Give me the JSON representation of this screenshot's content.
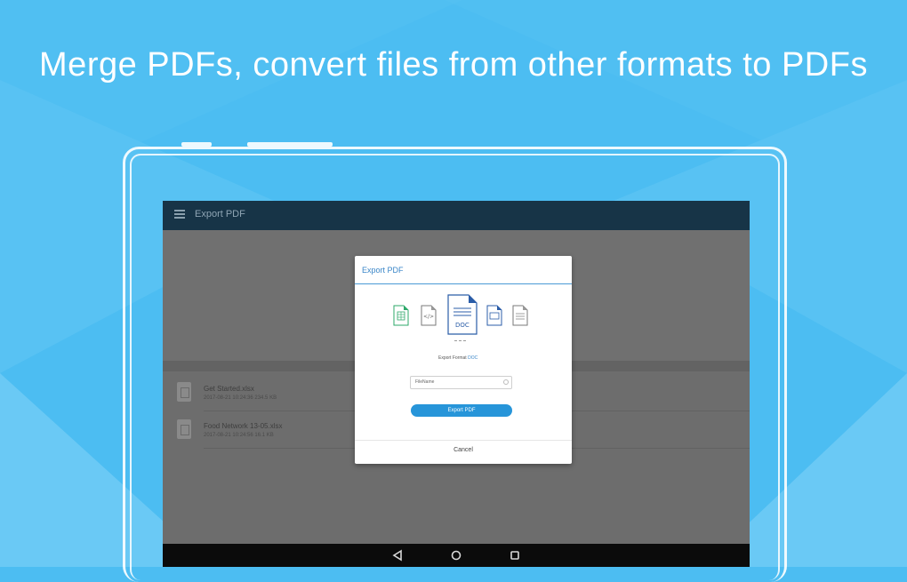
{
  "headline": "Merge PDFs, convert files from other formats to PDFs",
  "colors": {
    "background": "#4cbdf2",
    "app_bar": "#173447",
    "accent": "#2795d9",
    "dialog_title": "#3a86c8"
  },
  "app_bar": {
    "menu_icon": "menu-icon",
    "title": "Export PDF"
  },
  "files": [
    {
      "name": "Get Started.xlsx",
      "meta": "2017-08-21 10:24:36  234.5 KB"
    },
    {
      "name": "Food Network 13-05.xlsx",
      "meta": "2017-08-21 10:24:56  16.1 KB"
    }
  ],
  "dialog": {
    "title": "Export PDF",
    "format_icons": [
      "sheet-icon",
      "html-icon",
      "doc-icon",
      "image-icon",
      "text-icon"
    ],
    "export_format_label": "Export Format",
    "export_format_value": "DOC",
    "filename_placeholder": "FileName",
    "export_button": "Export PDF",
    "cancel_button": "Cancel"
  },
  "navbar": {
    "icons": [
      "back-icon",
      "home-icon",
      "recents-icon"
    ]
  }
}
